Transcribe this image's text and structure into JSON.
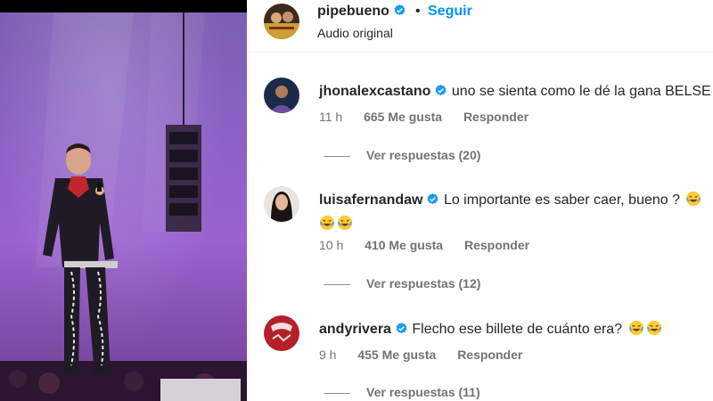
{
  "colors": {
    "accent": "#0095f6",
    "verified": "#1d9bf0",
    "text": "#262626",
    "muted": "#737373"
  },
  "video": {
    "icon": "concert-video-frame"
  },
  "post": {
    "author": "pipebueno",
    "separator": "•",
    "follow_label": "Seguir",
    "audio_label": "Audio original"
  },
  "comments": [
    {
      "username": "jhonalexcastano",
      "text": "uno se sienta como le dé la gana BELSE",
      "time": "11 h",
      "likes": "665 Me gusta",
      "reply_label": "Responder",
      "view_replies": "Ver respuestas (20)"
    },
    {
      "username": "luisafernandaw",
      "text": "Lo importante es saber caer, bueno ?",
      "time": "10 h",
      "likes": "410 Me gusta",
      "reply_label": "Responder",
      "view_replies": "Ver respuestas (12)"
    },
    {
      "username": "andyrivera",
      "text": "Flecho ese billete de cuánto era?",
      "time": "9 h",
      "likes": "455 Me gusta",
      "reply_label": "Responder",
      "view_replies": "Ver respuestas (11)"
    }
  ]
}
